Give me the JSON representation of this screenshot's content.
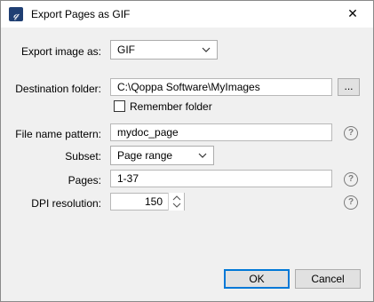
{
  "window": {
    "title": "Export Pages as GIF",
    "close_glyph": "✕",
    "app_icon_letter": "𝓆"
  },
  "export_as": {
    "label": "Export image as:",
    "selected": "GIF"
  },
  "destination": {
    "label": "Destination folder:",
    "value": "C:\\Qoppa Software\\MyImages",
    "browse_label": "...",
    "remember_label": "Remember folder",
    "remember_checked": false
  },
  "file_name": {
    "label": "File name pattern:",
    "value": "mydoc_page"
  },
  "subset": {
    "label": "Subset:",
    "selected": "Page range"
  },
  "pages": {
    "label": "Pages:",
    "value": "1-37"
  },
  "dpi": {
    "label": "DPI resolution:",
    "value": "150"
  },
  "help_glyph": "?",
  "buttons": {
    "ok": "OK",
    "cancel": "Cancel"
  }
}
